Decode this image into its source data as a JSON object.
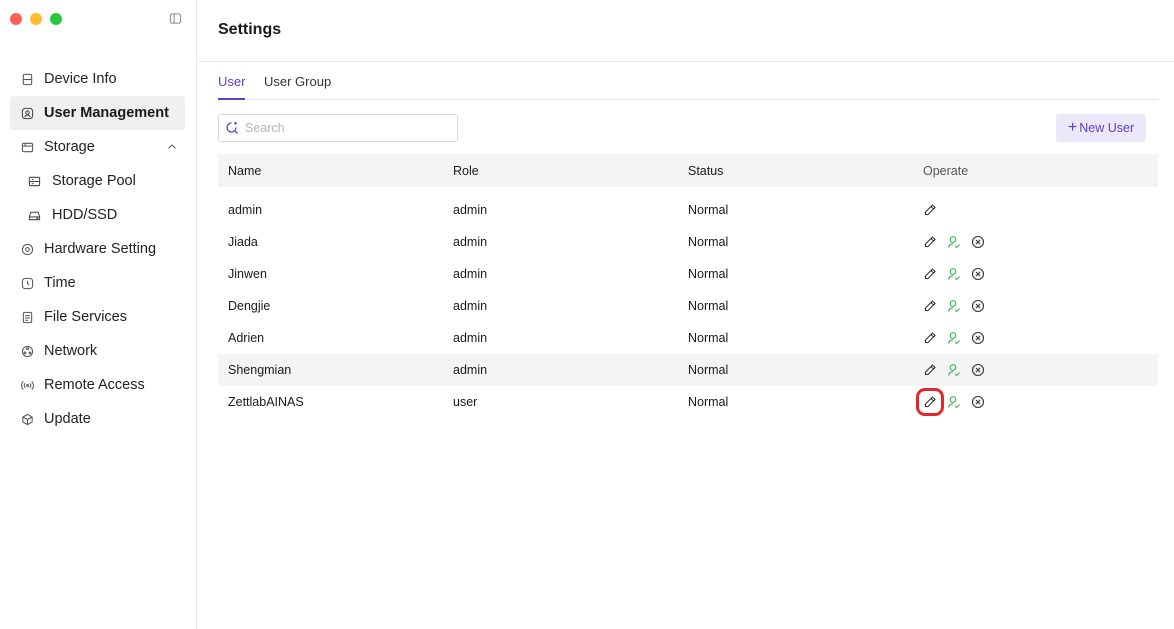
{
  "window": {
    "title": "Settings"
  },
  "sidebar": {
    "items": [
      {
        "label": "Device Info",
        "icon": "device-info-icon"
      },
      {
        "label": "User Management",
        "icon": "user-management-icon",
        "active": true
      },
      {
        "label": "Storage",
        "icon": "storage-icon",
        "expanded": true
      },
      {
        "label": "Storage Pool",
        "icon": "storage-pool-icon",
        "sub": true
      },
      {
        "label": "HDD/SSD",
        "icon": "hdd-icon",
        "sub": true
      },
      {
        "label": "Hardware Setting",
        "icon": "hardware-icon"
      },
      {
        "label": "Time",
        "icon": "clock-icon"
      },
      {
        "label": "File Services",
        "icon": "file-icon"
      },
      {
        "label": "Network",
        "icon": "network-icon"
      },
      {
        "label": "Remote Access",
        "icon": "remote-access-icon"
      },
      {
        "label": "Update",
        "icon": "update-icon"
      }
    ]
  },
  "tabs": [
    {
      "label": "User",
      "active": true
    },
    {
      "label": "User Group"
    }
  ],
  "search": {
    "placeholder": "Search"
  },
  "toolbar": {
    "new_user_label": "New User"
  },
  "table": {
    "columns": [
      "Name",
      "Role",
      "Status",
      "Operate"
    ],
    "rows": [
      {
        "name": "admin",
        "role": "admin",
        "status": "Normal"
      },
      {
        "name": "Jiada",
        "role": "admin",
        "status": "Normal"
      },
      {
        "name": "Jinwen",
        "role": "admin",
        "status": "Normal"
      },
      {
        "name": "Dengjie",
        "role": "admin",
        "status": "Normal"
      },
      {
        "name": "Adrien",
        "role": "admin",
        "status": "Normal"
      },
      {
        "name": "Shengmian",
        "role": "admin",
        "status": "Normal"
      },
      {
        "name": "ZettlabAINAS",
        "role": "user",
        "status": "Normal"
      }
    ]
  },
  "colors": {
    "accent": "#5b3fc4",
    "accent_bg": "#ece7fa",
    "green_icon": "#3fb24f",
    "highlight": "#e3262d"
  }
}
